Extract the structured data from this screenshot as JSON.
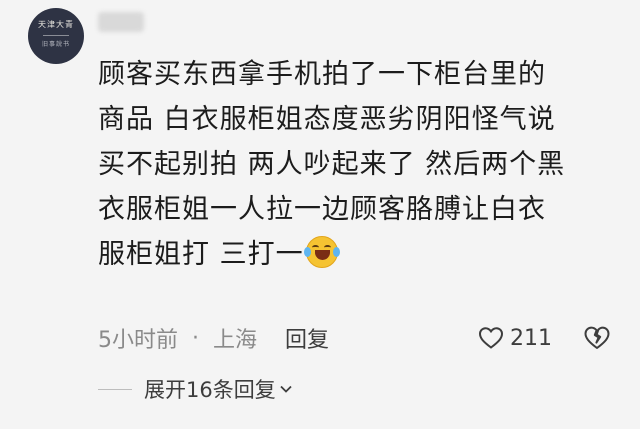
{
  "avatar": {
    "top_text": "天津大青",
    "bottom_text": "旧事說书"
  },
  "comment": {
    "lines": [
      "顾客买东西拿手机拍了一下柜台里的",
      "商品 白衣服柜姐态度恶劣阴阳怪气说",
      "买不起别拍 两人吵起来了 然后两个黑",
      "衣服柜姐一人拉一边顾客胳膊让白衣",
      "服柜姐打 三打一"
    ],
    "emoji": "grinning-squinting-tears-icon"
  },
  "meta": {
    "time": "5小时前",
    "separator": "·",
    "location": "上海",
    "reply_label": "回复",
    "like_count": "211"
  },
  "expand": {
    "label": "展开16条回复"
  },
  "colors": {
    "background": "#f4f4f4",
    "text": "#1c1c1c",
    "meta": "#8a8a8a"
  }
}
